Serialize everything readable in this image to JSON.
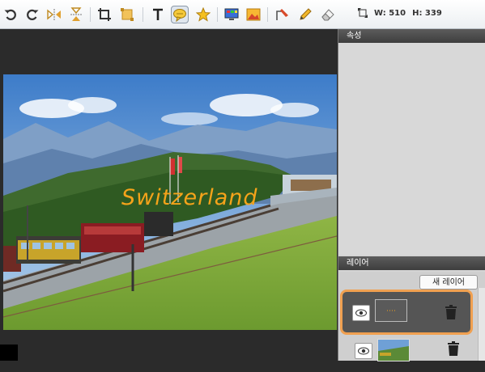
{
  "toolbar": {
    "tools": [
      "undo-icon",
      "redo-icon",
      "flip-horizontal-icon",
      "flip-vertical-icon",
      "crop-icon",
      "resize-icon",
      "text-icon",
      "speech-bubble-icon",
      "star-icon",
      "filter-icon",
      "image-effect-icon",
      "brush-icon",
      "pencil-icon",
      "eraser-icon"
    ],
    "selected_tool": "speech-bubble-icon",
    "width_label": "W: 510",
    "height_label": "H: 339"
  },
  "canvas": {
    "overlay_text": "Switzerland",
    "overlay_color": "#f5a31a"
  },
  "properties_panel": {
    "title": "속성"
  },
  "layers_panel": {
    "title": "레이어",
    "new_layer_label": "새 레이어",
    "layers": [
      {
        "type": "text",
        "selected": true
      },
      {
        "type": "image",
        "selected": false
      }
    ]
  },
  "colors": {
    "selection_outline": "#f0a050",
    "panel_header": "#4a4a4a"
  }
}
